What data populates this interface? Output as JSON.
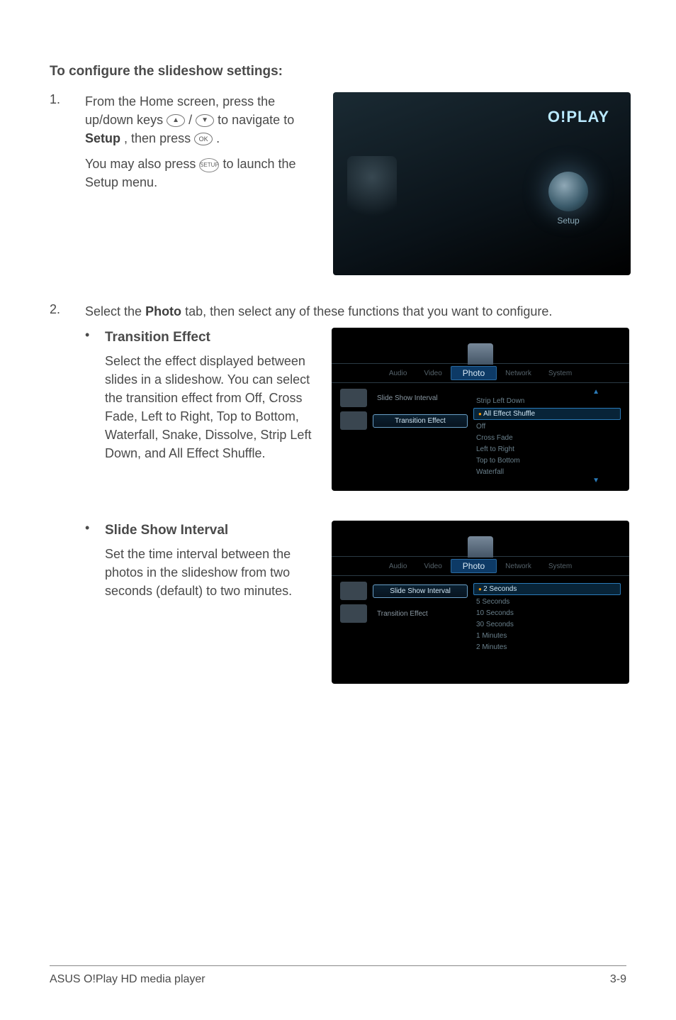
{
  "heading": "To configure the slideshow settings:",
  "steps": {
    "s1_num": "1.",
    "s1_line1_a": "From the Home screen, press the up/down keys ",
    "s1_line1_b": " / ",
    "s1_line1_c": " to navigate to ",
    "s1_setup": "Setup",
    "s1_line1_d": ", then press ",
    "s1_line1_e": ".",
    "s1_line2_a": "You may also press ",
    "s1_line2_b": " to launch the Setup menu.",
    "s2_num": "2.",
    "s2_text_a": "Select the ",
    "s2_photo": "Photo",
    "s2_text_b": " tab, then select any of these functions that you want to configure."
  },
  "bullets": {
    "b1_title": "Transition Effect",
    "b1_text": "Select the effect displayed between slides in a slideshow. You can select the transition effect from Off, Cross Fade, Left to Right, Top to Bottom, Waterfall, Snake, Dissolve, Strip Left Down, and All Effect Shuffle.",
    "b2_title": "Slide Show Interval",
    "b2_text": "Set the time interval between the photos in the slideshow from two seconds (default) to two minutes."
  },
  "device": {
    "logo": "O!PLAY",
    "setup_label": "Setup",
    "tab_photo": "Photo",
    "tab_audio": "Audio",
    "tab_video": "Video",
    "tab_network": "Network",
    "tab_system": "System",
    "menu1_left_item1": "Slide Show Interval",
    "menu1_left_item2": "Transition Effect",
    "menu1_opts": {
      "o0": "Strip Left Down",
      "o1": "All Effect Shuffle",
      "o2": "Off",
      "o3": "Cross Fade",
      "o4": "Left to Right",
      "o5": "Top to Bottom",
      "o6": "Waterfall"
    },
    "menu2_left_item1": "Slide Show Interval",
    "menu2_left_item2": "Transition Effect",
    "menu2_opts": {
      "o1": "2 Seconds",
      "o2": "5 Seconds",
      "o3": "10 Seconds",
      "o4": "30 Seconds",
      "o5": "1 Minutes",
      "o6": "2 Minutes"
    }
  },
  "icons": {
    "up": "▲",
    "down": "▼",
    "ok": "OK",
    "setup": "SETUP"
  },
  "footer": {
    "left": "ASUS O!Play HD media player",
    "right": "3-9"
  }
}
